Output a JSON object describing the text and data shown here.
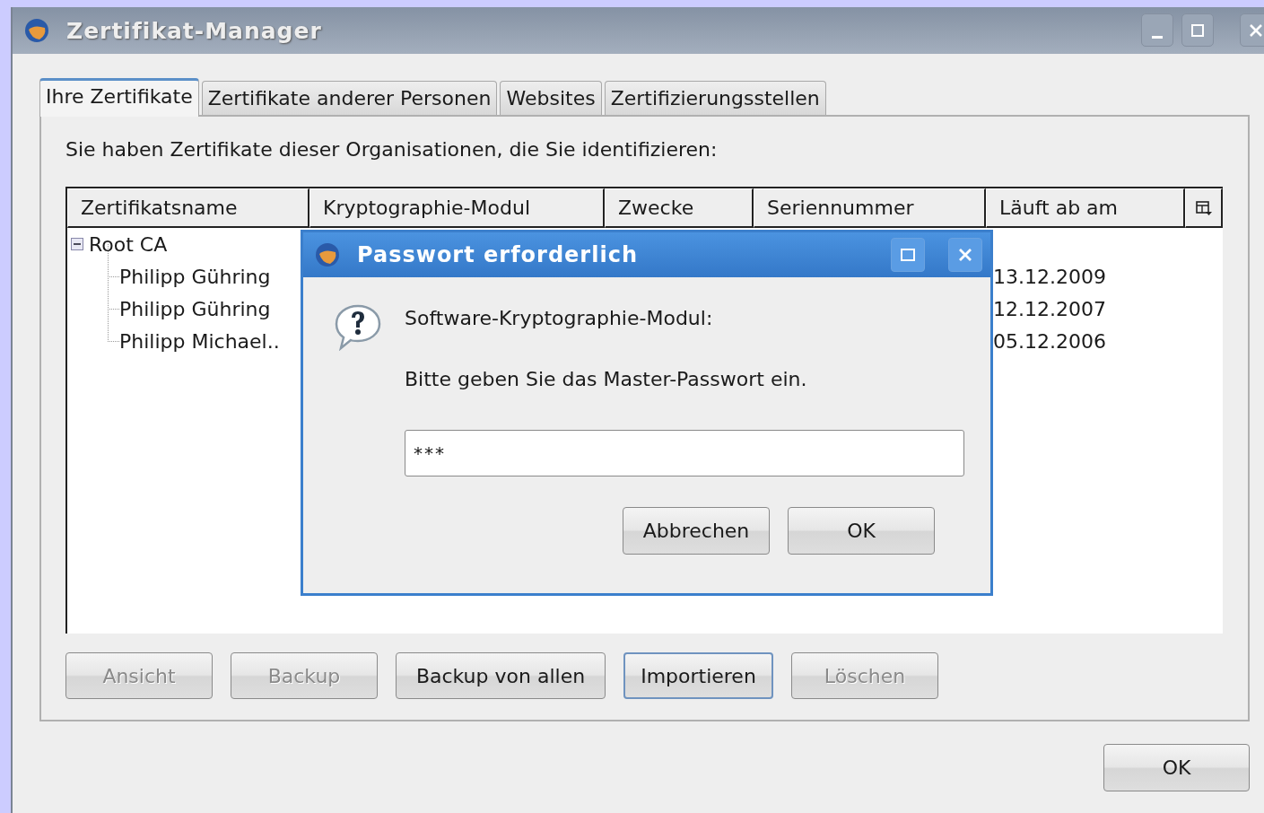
{
  "window": {
    "title": "Zertifikat-Manager"
  },
  "tabs": [
    {
      "label": "Ihre Zertifikate",
      "selected": true
    },
    {
      "label": "Zertifikate anderer Personen",
      "selected": false
    },
    {
      "label": "Websites",
      "selected": false
    },
    {
      "label": "Zertifizierungsstellen",
      "selected": false
    }
  ],
  "description": "Sie haben Zertifikate dieser Organisationen, die Sie identifizieren:",
  "table": {
    "columns": [
      "Zertifikatsname",
      "Kryptographie-Modul",
      "Zwecke",
      "Seriennummer",
      "Läuft ab am"
    ],
    "rows": [
      {
        "name": "Root CA",
        "expanded": true,
        "children": [
          {
            "name": "Philipp Gühring",
            "expires": "13.12.2009"
          },
          {
            "name": "Philipp Gühring",
            "expires": "12.12.2007"
          },
          {
            "name": "Philipp Michael..",
            "expires": "05.12.2006"
          }
        ]
      }
    ]
  },
  "buttons": [
    {
      "label": "Ansicht",
      "disabled": true,
      "focused": false
    },
    {
      "label": "Backup",
      "disabled": true,
      "focused": false
    },
    {
      "label": "Backup von allen",
      "disabled": false,
      "focused": false
    },
    {
      "label": "Importieren",
      "disabled": false,
      "focused": true
    },
    {
      "label": "Löschen",
      "disabled": true,
      "focused": false
    }
  ],
  "ok_button": "OK",
  "dialog": {
    "title": "Passwort erforderlich",
    "module": "Software-Kryptographie-Modul:",
    "prompt": "Bitte geben Sie das Master-Passwort ein.",
    "password": "***",
    "buttons": [
      "Abbrechen",
      "OK"
    ]
  }
}
